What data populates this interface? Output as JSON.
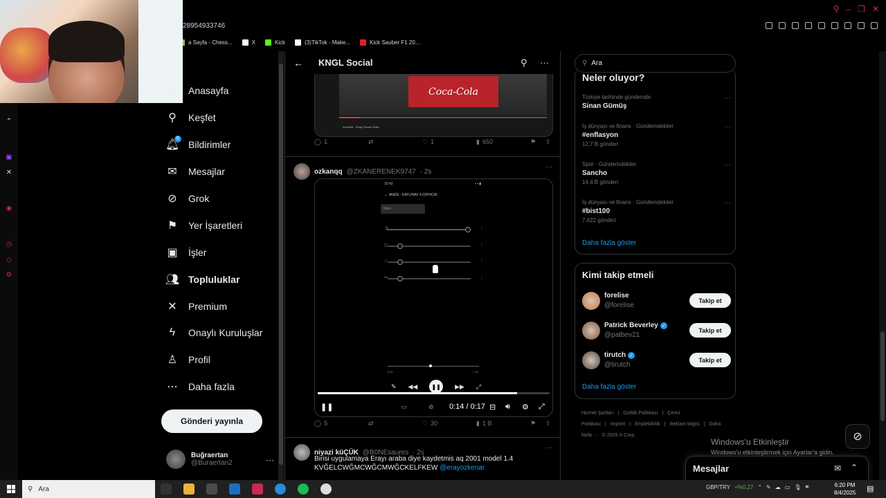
{
  "browser": {
    "url_fragment": "28954933746",
    "tabs": [
      {
        "label": "a Sayfa - Chess...",
        "color": "#8bc34a"
      },
      {
        "label": "X",
        "color": "#ffffff"
      },
      {
        "label": "Kick",
        "color": "#53fc18"
      },
      {
        "label": "(3)TikTok - Make...",
        "color": "#ffffff"
      },
      {
        "label": "Kick Sauber F1 20...",
        "color": "#e0202c"
      }
    ]
  },
  "nav": {
    "items": [
      {
        "label": "Anasayfa",
        "icon": "home-icon",
        "glyph": "⌂"
      },
      {
        "label": "Keşfet",
        "icon": "search-icon",
        "glyph": "⚲"
      },
      {
        "label": "Bildirimler",
        "icon": "bell-icon",
        "glyph": "🔔︎"
      },
      {
        "label": "Mesajlar",
        "icon": "mail-icon",
        "glyph": "✉"
      },
      {
        "label": "Grok",
        "icon": "grok-icon",
        "glyph": "⊘"
      },
      {
        "label": "Yer İşaretleri",
        "icon": "bookmark-icon",
        "glyph": "⚑"
      },
      {
        "label": "İşler",
        "icon": "briefcase-icon",
        "glyph": "▣"
      },
      {
        "label": "Topluluklar",
        "icon": "communities-icon",
        "glyph": "👥︎"
      },
      {
        "label": "Premium",
        "icon": "x-logo-icon",
        "glyph": "✕"
      },
      {
        "label": "Onaylı Kuruluşlar",
        "icon": "lightning-icon",
        "glyph": "ϟ"
      },
      {
        "label": "Profil",
        "icon": "profile-icon",
        "glyph": "♙"
      },
      {
        "label": "Daha fazla",
        "icon": "more-circle-icon",
        "glyph": "⋯"
      }
    ],
    "notification_badge": "6",
    "post_button": "Gönderi yayınla",
    "account": {
      "name": "Buğraertan",
      "handle": "@Buraertan2"
    }
  },
  "main": {
    "header_title": "KNGL Social",
    "prev_tweet": {
      "video_title": "manifest - Snap | Music Video",
      "replies": "1",
      "likes": "1",
      "views": "650"
    },
    "tweet1": {
      "name": "ozkanqq",
      "handle": "@ZKANERENEK9747",
      "time": "· 2s",
      "phone_time": "15:43",
      "phone_title": "ANİZE - KATLİHAV 4 (OFFICIA",
      "phone_button": "Bilmi",
      "seek_start": "0:41",
      "seek_end": "-1:42",
      "video_progress": 0.86,
      "time_display": "0:14 / 0:17",
      "replies": "5",
      "likes": "30",
      "views": "1 B"
    },
    "tweet2": {
      "name": "niyazi küÇÜK",
      "handle": "@B0NEsaures",
      "time": "· 2s",
      "text": "Birisi uygulamaya Erayı araba diye kaydetmis aq 2001 model 1.4 KVĞELCWĞMCWĞCMWĞCKELFKEW",
      "mention": "@erayozkenar"
    }
  },
  "right": {
    "search_placeholder": "Ara",
    "trends_title": "Neler oluyor?",
    "trends": [
      {
        "context": "Türkiye tarihinde gündemde",
        "title": "Sinan Gümüş",
        "count": ""
      },
      {
        "context": "İş dünyası ve finans · Gündemdekiler",
        "title": "#enflasyon",
        "count": "12,7 B gönderi"
      },
      {
        "context": "Spor · Gündemdekiler",
        "title": "Sancho",
        "count": "14,4 B gönderi"
      },
      {
        "context": "İş dünyası ve finans · Gündemdekiler",
        "title": "#bist100",
        "count": "7.622 gönderi"
      }
    ],
    "show_more": "Daha fazla göster",
    "follow_title": "Kimi takip etmeli",
    "follow": [
      {
        "name": "forelise",
        "handle": "@foreIise",
        "verified": false,
        "avatar": "#c8794f"
      },
      {
        "name": "Patrick Beverley",
        "handle": "@patbev21",
        "verified": true,
        "avatar": "#7a5a44"
      },
      {
        "name": "tirutch",
        "handle": "@tirutch",
        "verified": true,
        "avatar": "#4a4a4a"
      }
    ],
    "follow_button": "Takip et",
    "footer": [
      "Hizmet Şartları",
      "|",
      "Gizlilik Politikası",
      "|",
      "Çerez Politikası",
      "|",
      "Imprint",
      "|",
      "Erişilebilirlik",
      "|",
      "Reklam bilgisi",
      "|",
      "Daha fazla ···",
      "© 2025 X Corp."
    ]
  },
  "activation": {
    "line1": "Windows'u Etkinleştir",
    "line2": "Windows'u etkinleştirmek için Ayarlar'a gidin."
  },
  "messages_dock": "Mesajlar",
  "taskbar": {
    "search": "Ara",
    "ticker": "GBP/TRY",
    "ticker_change": "+%0,27",
    "time": "6:20 PM",
    "date": "8/4/2025"
  }
}
